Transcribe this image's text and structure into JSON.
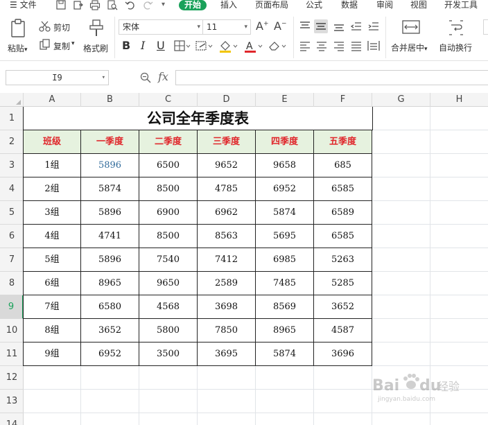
{
  "menu": {
    "file": "文件",
    "tabs": [
      {
        "label": "开始",
        "active": true
      },
      {
        "label": "插入"
      },
      {
        "label": "页面布局"
      },
      {
        "label": "公式"
      },
      {
        "label": "数据"
      },
      {
        "label": "审阅"
      },
      {
        "label": "视图"
      },
      {
        "label": "开发工具"
      }
    ]
  },
  "ribbon": {
    "paste": "粘贴",
    "cut": "剪切",
    "copy": "复制",
    "format_painter": "格式刷",
    "font_name": "宋体",
    "font_size": "11",
    "merge_center": "合并居中",
    "wrap_text": "自动换行"
  },
  "formula_bar": {
    "name_box": "I9",
    "fx": "fx",
    "value": ""
  },
  "grid": {
    "columns": [
      "A",
      "B",
      "C",
      "D",
      "E",
      "F",
      "G",
      "H"
    ],
    "rows": [
      "1",
      "2",
      "3",
      "4",
      "5",
      "6",
      "7",
      "8",
      "9",
      "10",
      "11",
      "12",
      "13",
      "14"
    ],
    "active_row": "9",
    "title": "公司全年季度表",
    "headers": [
      "班级",
      "一季度",
      "二季度",
      "三季度",
      "四季度",
      "五季度"
    ],
    "data": [
      [
        "1组",
        "5896",
        "6500",
        "9652",
        "9658",
        "685"
      ],
      [
        "2组",
        "5874",
        "8500",
        "4785",
        "6952",
        "6585"
      ],
      [
        "3组",
        "5896",
        "6900",
        "6962",
        "5874",
        "6589"
      ],
      [
        "4组",
        "4741",
        "8500",
        "8563",
        "5695",
        "6585"
      ],
      [
        "5组",
        "5896",
        "7540",
        "7412",
        "6985",
        "5263"
      ],
      [
        "6组",
        "8965",
        "9650",
        "2589",
        "7485",
        "5285"
      ],
      [
        "7组",
        "6580",
        "4568",
        "3698",
        "8569",
        "3652"
      ],
      [
        "8组",
        "3652",
        "5800",
        "7850",
        "8965",
        "4587"
      ],
      [
        "9组",
        "6952",
        "3500",
        "3695",
        "5874",
        "3696"
      ]
    ]
  },
  "watermark": {
    "brand": "Bai",
    "brand2": "du",
    "suffix": "经验",
    "url": "jingyan.baidu.com"
  },
  "colors": {
    "accent": "#1aa15a",
    "header_fill": "#e6f2df",
    "header_text": "#e0262b"
  }
}
